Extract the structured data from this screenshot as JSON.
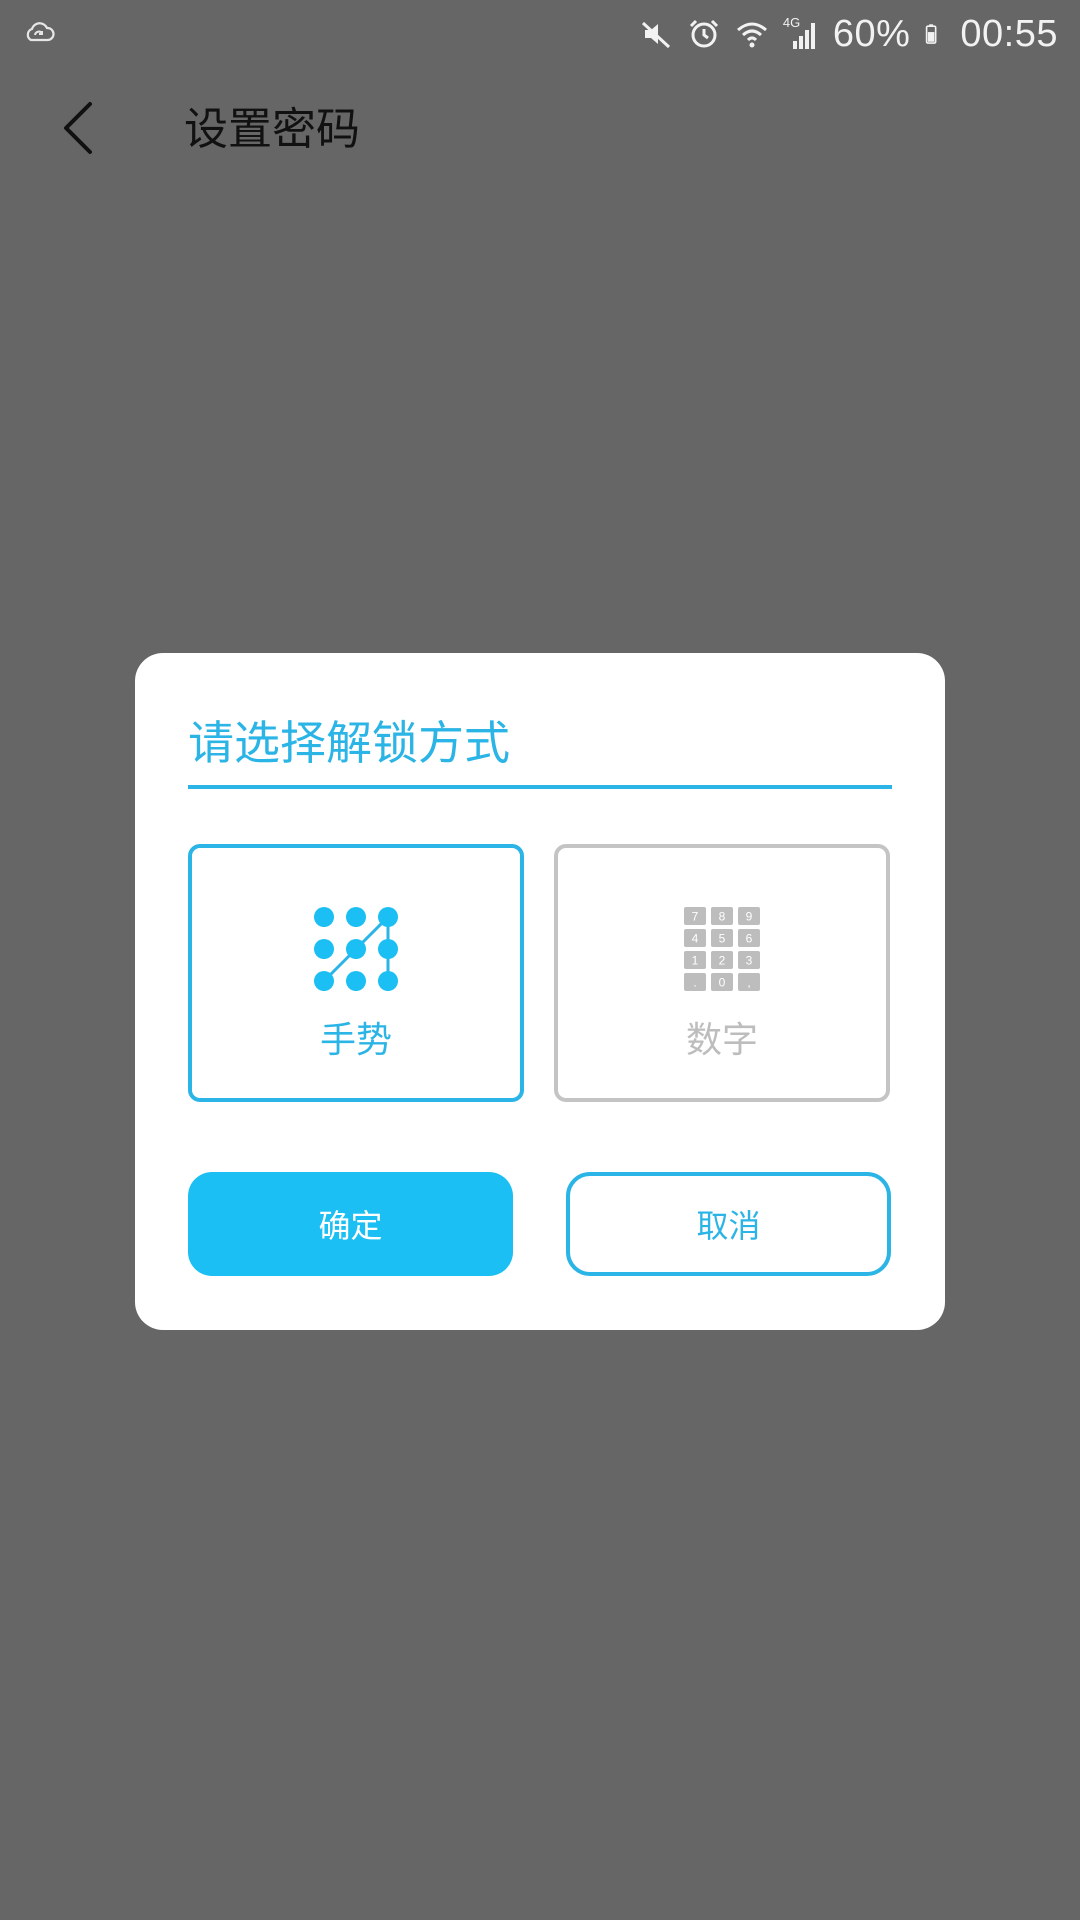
{
  "status_bar": {
    "left_icon": "cloud-sync-icon",
    "icons": [
      "mute-icon",
      "alarm-icon",
      "wifi-icon",
      "cellular-4g-icon"
    ],
    "network_label": "4G",
    "battery": "60%",
    "time": "00:55"
  },
  "header": {
    "back_icon": "chevron-left-icon",
    "title": "设置密码"
  },
  "dialog": {
    "title": "请选择解锁方式",
    "options": [
      {
        "label": "手势",
        "icon": "pattern-grid-icon",
        "selected": true
      },
      {
        "label": "数字",
        "icon": "numeric-keypad-icon",
        "selected": false
      }
    ],
    "keypad_keys": [
      "7",
      "8",
      "9",
      "4",
      "5",
      "6",
      "1",
      "2",
      "3",
      ".",
      "0",
      ","
    ],
    "confirm_label": "确定",
    "cancel_label": "取消"
  },
  "colors": {
    "accent": "#2bb4e6",
    "confirm_bg": "#1bbff4",
    "overlay_bg": "#666666",
    "inactive": "#bdbdbd"
  }
}
